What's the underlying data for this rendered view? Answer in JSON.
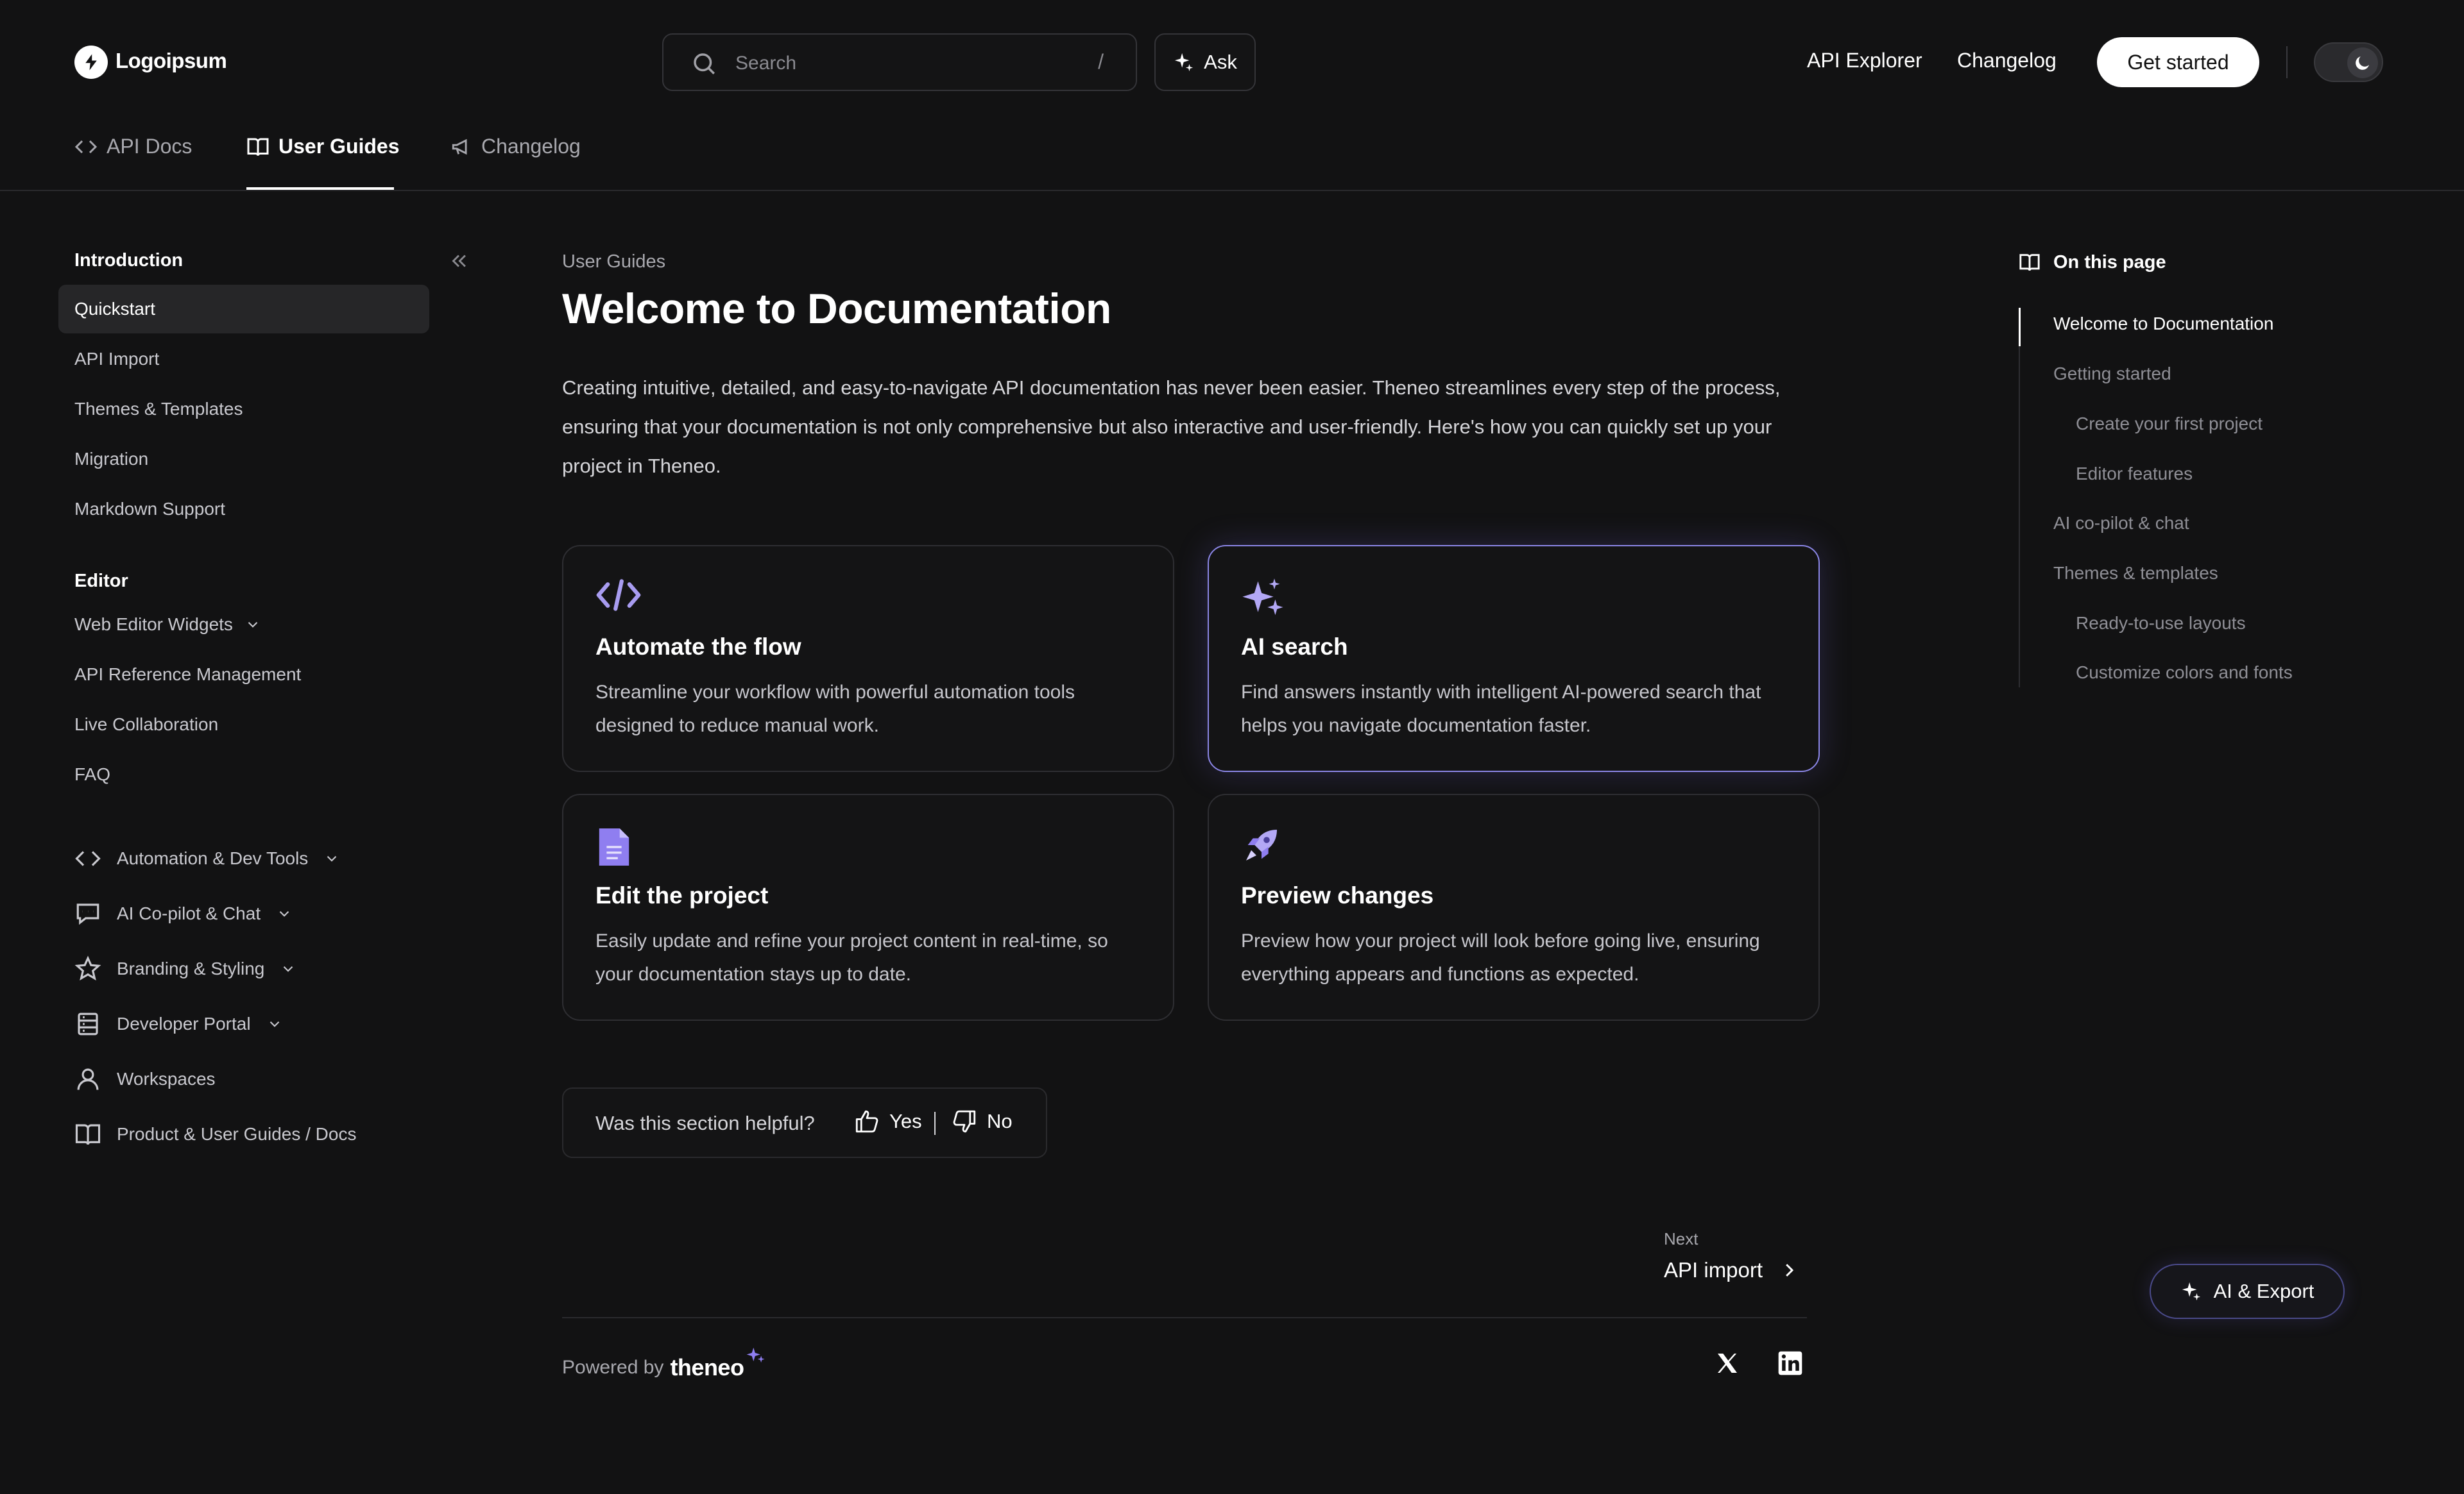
{
  "header": {
    "logo_text": "Logoipsum",
    "search_placeholder": "Search",
    "search_shortcut": "/",
    "ask_label": "Ask",
    "links": [
      "API Explorer",
      "Changelog"
    ],
    "cta_label": "Get started"
  },
  "tabs": [
    {
      "label": "API Docs",
      "icon": "code-icon"
    },
    {
      "label": "User Guides",
      "icon": "book-icon",
      "active": true
    },
    {
      "label": "Changelog",
      "icon": "megaphone-icon"
    }
  ],
  "sidebar": {
    "sections": [
      {
        "title": "Introduction",
        "items": [
          "Quickstart",
          "API Import",
          "Themes & Templates",
          "Migration",
          "Markdown Support"
        ],
        "active": "Quickstart"
      },
      {
        "title": "Editor",
        "items": [
          "Web Editor Widgets",
          "API Reference Management",
          "Live Collaboration",
          "FAQ"
        ]
      }
    ],
    "groups": [
      {
        "label": "Automation & Dev Tools",
        "icon": "code-icon",
        "expandable": true
      },
      {
        "label": "AI Co-pilot & Chat",
        "icon": "chat-icon",
        "expandable": true
      },
      {
        "label": "Branding & Styling",
        "icon": "star-icon",
        "expandable": true
      },
      {
        "label": "Developer Portal",
        "icon": "server-icon",
        "expandable": true
      },
      {
        "label": "Workspaces",
        "icon": "user-icon",
        "expandable": false
      },
      {
        "label": "Product & User Guides / Docs",
        "icon": "book-icon",
        "expandable": false
      }
    ]
  },
  "main": {
    "breadcrumb": "User Guides",
    "title": "Welcome to Documentation",
    "intro": "Creating intuitive, detailed, and easy-to-navigate API documentation has never been easier. Theneo streamlines every step of the process, ensuring that your documentation is not only comprehensive but also interactive and user-friendly. Here's how you can quickly set up your project in Theneo.",
    "cards": [
      {
        "title": "Automate the flow",
        "desc": "Streamline your workflow with powerful automation tools designed to reduce manual work.",
        "icon": "code-icon"
      },
      {
        "title": "AI search",
        "desc": "Find answers instantly with intelligent AI-powered search that helps you navigate documentation faster.",
        "icon": "sparkle-icon"
      },
      {
        "title": "Edit the project",
        "desc": "Easily update and refine your project content in real-time, so your documentation stays up to date.",
        "icon": "document-icon"
      },
      {
        "title": "Preview changes",
        "desc": "Preview how your project will look before going live, ensuring everything appears and functions as expected.",
        "icon": "rocket-icon"
      }
    ],
    "feedback": {
      "question": "Was this section helpful?",
      "yes": "Yes",
      "no": "No"
    },
    "next": {
      "label": "Next",
      "title": "API import"
    },
    "powered_by": "Powered by",
    "brand": "theneo"
  },
  "toc": {
    "title": "On this page",
    "items": [
      {
        "label": "Welcome to Documentation",
        "level": 1,
        "active": true
      },
      {
        "label": "Getting started",
        "level": 1
      },
      {
        "label": "Create your first project",
        "level": 2
      },
      {
        "label": "Editor features",
        "level": 2
      },
      {
        "label": "AI co-pilot & chat",
        "level": 1
      },
      {
        "label": "Themes & templates",
        "level": 1
      },
      {
        "label": "Ready-to-use layouts",
        "level": 2
      },
      {
        "label": "Customize colors and fonts",
        "level": 2
      }
    ]
  },
  "ai_export_label": "AI & Export",
  "colors": {
    "accent": "#8b86e6",
    "background": "#121213"
  }
}
